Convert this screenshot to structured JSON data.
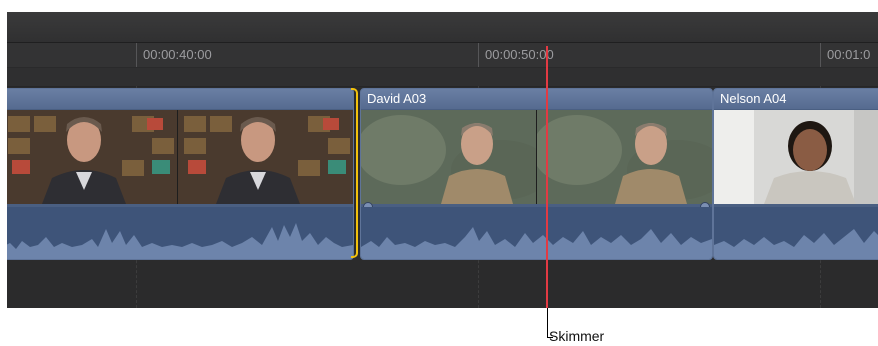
{
  "ruler": {
    "timecodes": [
      "00:00:40:00",
      "00:00:50:00",
      "00:01:0"
    ]
  },
  "clips": [
    {
      "name": "",
      "selected": true
    },
    {
      "name": "David A03",
      "selected": false
    },
    {
      "name": "Nelson A04",
      "selected": false
    }
  ],
  "callout": {
    "label": "Skimmer"
  },
  "colors": {
    "timeline_bg": "#2b2b2c",
    "clip_blue": "#4a5f82",
    "selection_yellow": "#f3c20c",
    "skimmer_red": "#e23a43"
  }
}
